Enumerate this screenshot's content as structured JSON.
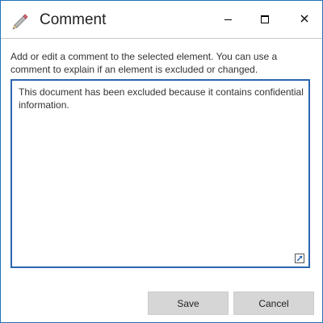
{
  "window": {
    "title": "Comment",
    "title_icon": "pencil-icon",
    "controls": [
      "minimize-icon",
      "maximize-icon",
      "close-icon"
    ]
  },
  "instructions": "Add or edit a comment to the selected element. You can use a comment to explain if an element is excluded or changed.",
  "comment": {
    "value": "This document has been excluded because it contains confidential information.",
    "resize_icon": "expand-icon"
  },
  "buttons": {
    "save_label": "Save",
    "cancel_label": "Cancel"
  },
  "colors": {
    "border_accent": "#2b66ad",
    "button_bg": "#d6d6d6"
  }
}
